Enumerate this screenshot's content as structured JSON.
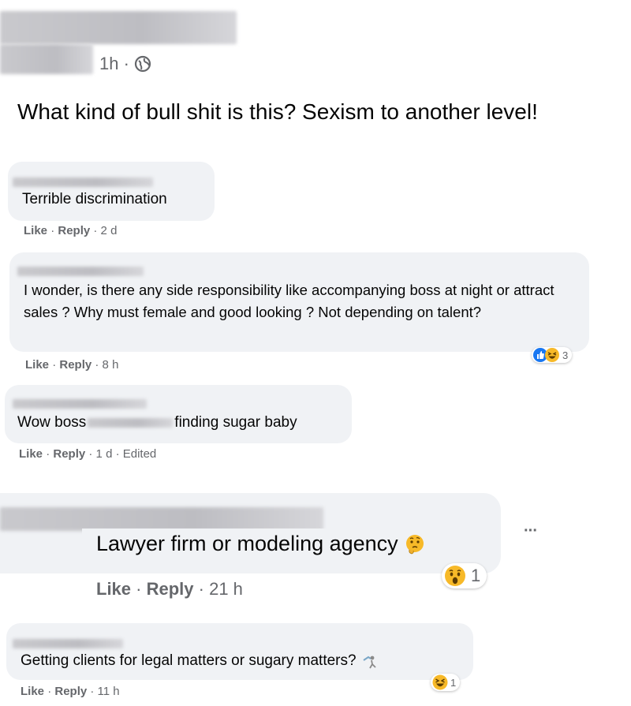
{
  "post": {
    "meta": "1h ·",
    "text": "What kind of bull shit is this? Sexism to another level!"
  },
  "comments": [
    {
      "text": "Terrible discrimination",
      "like": "Like",
      "sep": "·",
      "reply": "Reply",
      "time": "· 2 d"
    },
    {
      "text": "I wonder, is there any side responsibility like accompanying boss at night or attract sales ? Why must female and good looking ? Not depending on talent?",
      "like": "Like",
      "sep": "·",
      "reply": "Reply",
      "time": "· 8 h",
      "reaction_count": "3"
    },
    {
      "text_before": "Wow boss",
      "text_after": "finding sugar baby",
      "like": "Like",
      "sep": "·",
      "reply": "Reply",
      "time": "· 1 d · Edited"
    },
    {
      "text": "Lawyer firm or modeling agency",
      "like": "Like",
      "sep": "·",
      "reply": "Reply",
      "time": "· 21 h",
      "reaction_count": "1",
      "more": "···"
    },
    {
      "text": "Getting clients for legal matters or sugary matters?",
      "like": "Like",
      "sep": "·",
      "reply": "Reply",
      "time": "· 11 h",
      "reaction_count": "1"
    }
  ],
  "icons": {
    "globe": "globe-icon",
    "like_reaction": "like-reaction-icon",
    "haha_reaction": "haha-reaction-icon",
    "wow_reaction": "wow-reaction-icon",
    "thinking_emoji": "thinking-emoji-icon"
  },
  "colors": {
    "like_blue": "#1877f2",
    "reaction_yellow": "#f7b928",
    "muted": "#65676b",
    "bubble": "#f0f2f5"
  }
}
